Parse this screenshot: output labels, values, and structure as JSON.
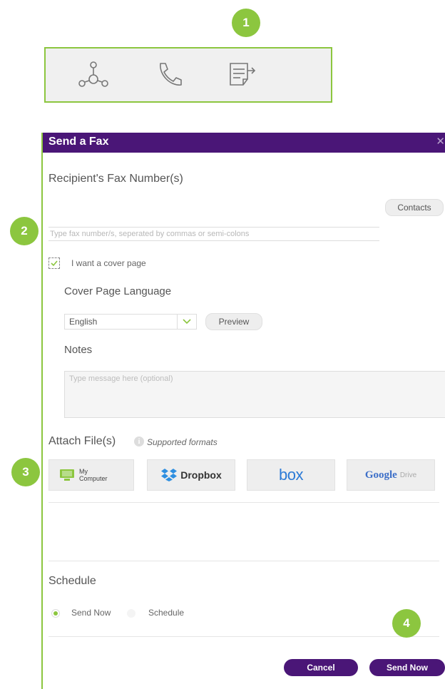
{
  "badges": {
    "one": "1",
    "two": "2",
    "three": "3",
    "four": "4"
  },
  "toolbar": {
    "icons": [
      "network-icon",
      "phone-icon",
      "send-fax-icon"
    ]
  },
  "dialog": {
    "title": "Send a Fax",
    "close_symbol": "✕",
    "recipient_heading": "Recipient's Fax Number(s)",
    "contacts_label": "Contacts",
    "fax_placeholder": "Type fax number/s, seperated by commas or semi-colons",
    "cover_page_label": "I want a cover page",
    "cover_page_checked": true,
    "cover_language_heading": "Cover Page Language",
    "language_value": "English",
    "preview_label": "Preview",
    "notes_heading": "Notes",
    "notes_placeholder": "Type message here (optional)",
    "attach_heading": "Attach File(s)",
    "supported_formats": "Supported formats",
    "attach_sources": [
      {
        "line1": "My",
        "line2": "Computer"
      },
      {
        "label": "Dropbox"
      },
      {
        "label": "box"
      },
      {
        "label": "Google",
        "sub": "Drive"
      }
    ],
    "schedule_heading": "Schedule",
    "schedule_options": [
      {
        "label": "Send Now",
        "selected": true
      },
      {
        "label": "Schedule",
        "selected": false
      }
    ],
    "cancel_label": "Cancel",
    "send_label": "Send Now"
  },
  "colors": {
    "accent_green": "#8cc63f",
    "brand_purple": "#4a1677"
  }
}
